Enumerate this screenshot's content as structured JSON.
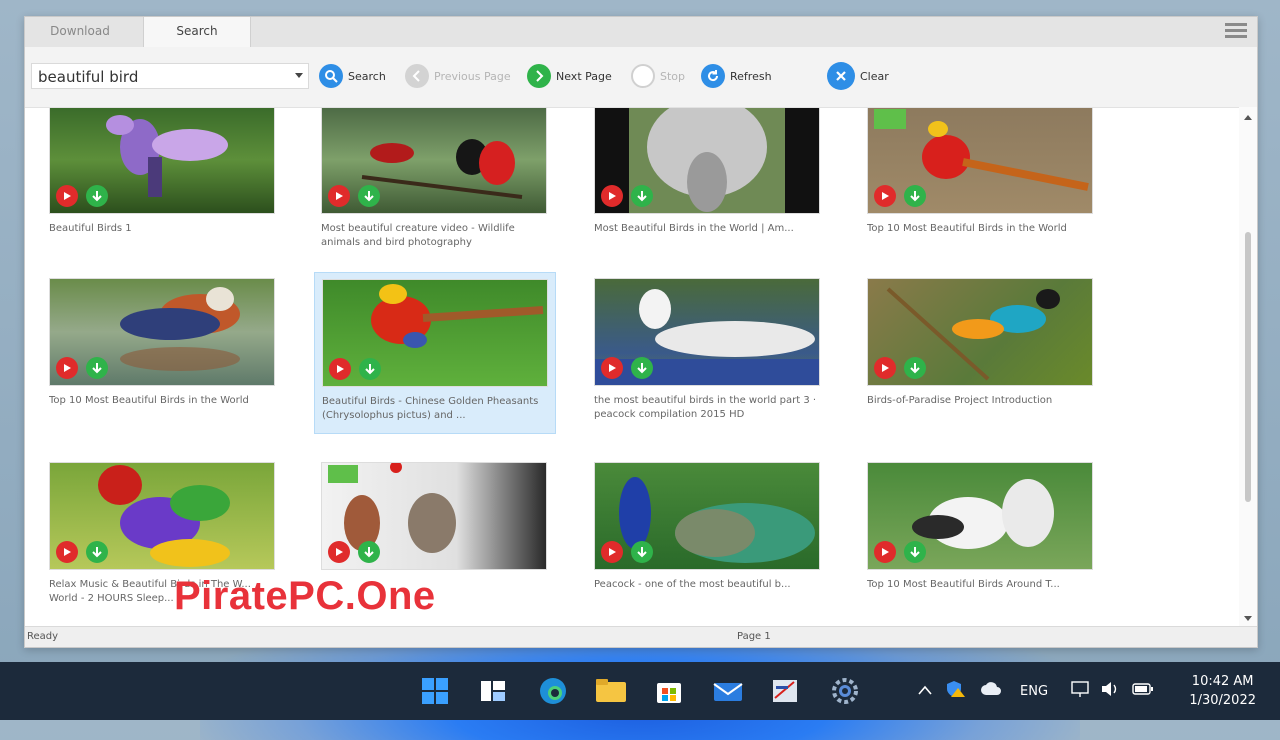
{
  "window": {
    "tabs": [
      {
        "label": "Download"
      },
      {
        "label": "Search"
      }
    ]
  },
  "toolbar": {
    "search_value": "beautiful bird",
    "search_label": "Search",
    "prev_label": "Previous Page",
    "next_label": "Next Page",
    "stop_label": "Stop",
    "refresh_label": "Refresh",
    "clear_label": "Clear"
  },
  "colors": {
    "play": "#e02b2b",
    "download": "#2fb34a",
    "toolbar_blue": "#2e8ee6",
    "selection": "#d9ecfb"
  },
  "results": [
    {
      "title": "Beautiful Birds 1"
    },
    {
      "title": "Most beautiful creature video - Wildlife animals and bird photography"
    },
    {
      "title": "Most Beautiful Birds in the World | Am..."
    },
    {
      "title": "Top 10 Most Beautiful Birds in the World"
    },
    {
      "title": "Top 10 Most Beautiful Birds in the World"
    },
    {
      "title": "Beautiful Birds - Chinese Golden Pheasants (Chrysolophus pictus) and ..."
    },
    {
      "title": "the most beautiful birds in the world part 3 · peacock compilation 2015 HD"
    },
    {
      "title": "Birds-of-Paradise Project Introduction"
    },
    {
      "title": "Relax Music & Beautiful Birds in The W... World - 2 HOURS Sleep..."
    },
    {
      "title": ""
    },
    {
      "title": "Peacock - one of the most beautiful b..."
    },
    {
      "title": "Top 10 Most Beautiful Birds Around T..."
    }
  ],
  "status": {
    "left": "Ready",
    "center": "Page 1"
  },
  "watermark": "PiratePC.One",
  "taskbar": {
    "lang": "ENG",
    "time": "10:42 AM",
    "date": "1/30/2022",
    "icons": [
      "windows-start-icon",
      "task-view-icon",
      "edge-browser-icon",
      "file-explorer-icon",
      "store-icon",
      "mail-icon",
      "app-icon",
      "settings-icon"
    ]
  }
}
